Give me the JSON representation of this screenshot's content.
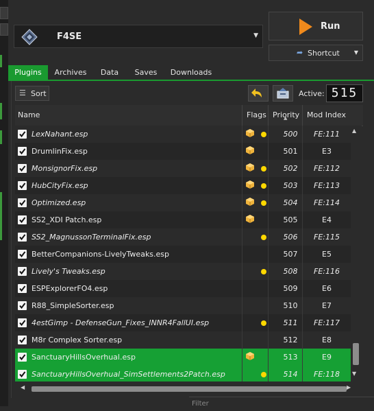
{
  "profile": {
    "name": "F4SE"
  },
  "run": {
    "label": "Run"
  },
  "shortcut": {
    "label": "Shortcut"
  },
  "tabs": [
    {
      "label": "Plugins",
      "active": true
    },
    {
      "label": "Archives",
      "active": false
    },
    {
      "label": "Data",
      "active": false
    },
    {
      "label": "Saves",
      "active": false
    },
    {
      "label": "Downloads",
      "active": false
    }
  ],
  "toolbar": {
    "sort_label": "Sort",
    "active_label": "Active:",
    "active_count": "515"
  },
  "table": {
    "columns": [
      "Name",
      "Flags",
      "Priority",
      "Mod Index"
    ],
    "rows": [
      {
        "name": "LexNahant.esp",
        "italic": true,
        "box": true,
        "dot": true,
        "priority": "500",
        "index": "FE:111",
        "selected": false
      },
      {
        "name": "DrumlinFix.esp",
        "italic": false,
        "box": true,
        "dot": false,
        "priority": "501",
        "index": "E3",
        "selected": false
      },
      {
        "name": "MonsignorFix.esp",
        "italic": true,
        "box": true,
        "dot": true,
        "priority": "502",
        "index": "FE:112",
        "selected": false
      },
      {
        "name": "HubCityFix.esp",
        "italic": true,
        "box": true,
        "dot": true,
        "priority": "503",
        "index": "FE:113",
        "selected": false
      },
      {
        "name": "Optimized.esp",
        "italic": true,
        "box": true,
        "dot": true,
        "priority": "504",
        "index": "FE:114",
        "selected": false
      },
      {
        "name": "SS2_XDI Patch.esp",
        "italic": false,
        "box": true,
        "dot": false,
        "priority": "505",
        "index": "E4",
        "selected": false
      },
      {
        "name": "SS2_MagnussonTerminalFix.esp",
        "italic": true,
        "box": false,
        "dot": true,
        "priority": "506",
        "index": "FE:115",
        "selected": false
      },
      {
        "name": "BetterCompanions-LivelyTweaks.esp",
        "italic": false,
        "box": false,
        "dot": false,
        "priority": "507",
        "index": "E5",
        "selected": false
      },
      {
        "name": "Lively's Tweaks.esp",
        "italic": true,
        "box": false,
        "dot": true,
        "priority": "508",
        "index": "FE:116",
        "selected": false
      },
      {
        "name": "ESPExplorerFO4.esp",
        "italic": false,
        "box": false,
        "dot": false,
        "priority": "509",
        "index": "E6",
        "selected": false
      },
      {
        "name": "R88_SimpleSorter.esp",
        "italic": false,
        "box": false,
        "dot": false,
        "priority": "510",
        "index": "E7",
        "selected": false
      },
      {
        "name": "4estGimp - DefenseGun_Fixes_INNR4FallUI.esp",
        "italic": true,
        "box": false,
        "dot": true,
        "priority": "511",
        "index": "FE:117",
        "selected": false
      },
      {
        "name": "M8r Complex Sorter.esp",
        "italic": false,
        "box": false,
        "dot": false,
        "priority": "512",
        "index": "E8",
        "selected": false
      },
      {
        "name": "SanctuaryHillsOverhual.esp",
        "italic": false,
        "box": true,
        "dot": false,
        "priority": "513",
        "index": "E9",
        "selected": true
      },
      {
        "name": "SanctuaryHillsOverhual_SimSettlements2Patch.esp",
        "italic": true,
        "box": false,
        "dot": true,
        "priority": "514",
        "index": "FE:118",
        "selected": true
      }
    ]
  },
  "filter": {
    "placeholder": "Filter"
  },
  "colors": {
    "accent": "#1a9a30",
    "selected_row": "#16a034",
    "flag_dot": "#ffd800",
    "run_icon": "#f08a1c"
  },
  "icons": [
    "f4se-logo-icon",
    "chevron-down-icon",
    "play-icon",
    "shortcut-arrow-icon",
    "sort-icon",
    "undo-icon",
    "backup-icon",
    "check-icon",
    "flag-box-icon",
    "flag-dot-icon"
  ]
}
